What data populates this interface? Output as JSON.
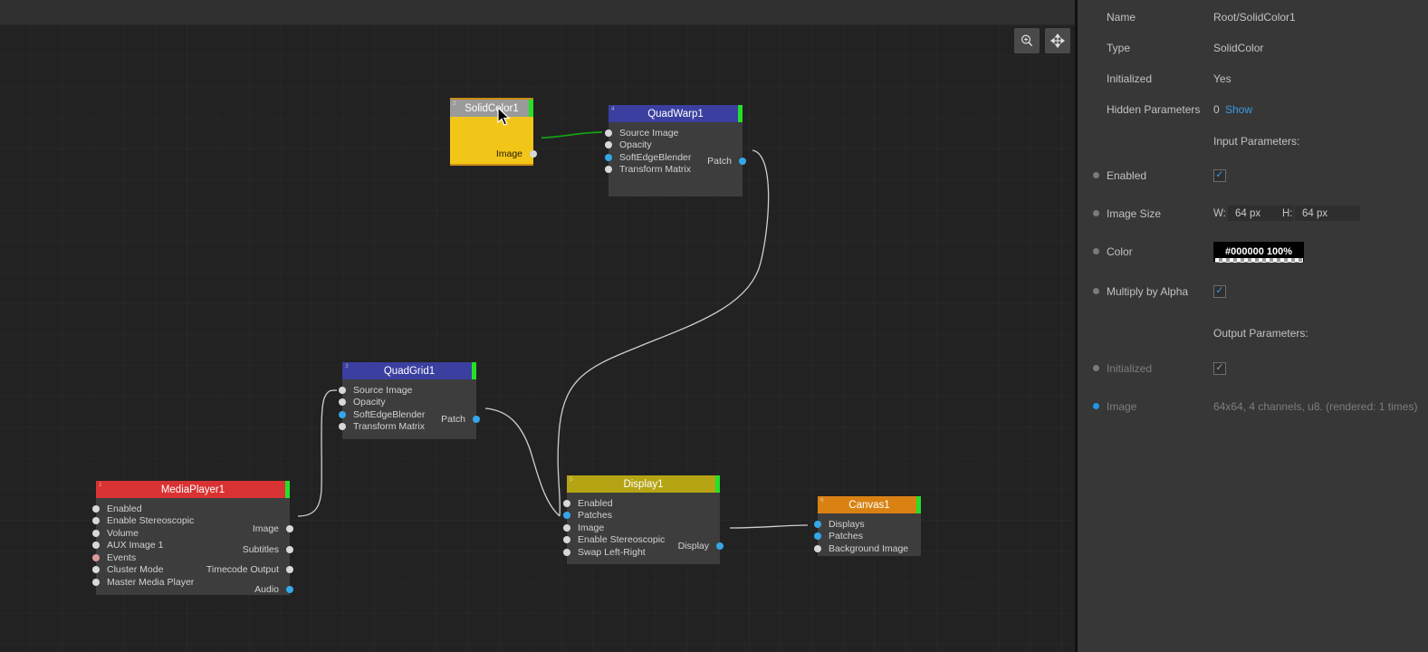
{
  "toolbar": {
    "buttons": [
      {
        "name": "zoom-in-button",
        "icon": "magnifier-plus-icon",
        "label": "Zoom"
      },
      {
        "name": "pan-button",
        "icon": "move-arrows-icon",
        "label": "Pan"
      }
    ]
  },
  "graph": {
    "nodes": [
      {
        "id": "mediaplayer1",
        "index": "1",
        "title": "MediaPlayer1",
        "header_color": "#d93232",
        "accent_color": "#26e028",
        "selected": false,
        "inputs": [
          {
            "label": "Enabled",
            "port": "white"
          },
          {
            "label": "Enable Stereoscopic",
            "port": "white"
          },
          {
            "label": "Volume",
            "port": "white"
          },
          {
            "label": "AUX Image 1",
            "port": "white"
          },
          {
            "label": "Events",
            "port": "pink"
          },
          {
            "label": "Cluster Mode",
            "port": "white"
          },
          {
            "label": "Master Media Player",
            "port": "white"
          }
        ],
        "outputs": [
          {
            "label": "Image",
            "port": "white"
          },
          {
            "label": "Subtitles",
            "port": "white"
          },
          {
            "label": "Timecode Output",
            "port": "white"
          },
          {
            "label": "Audio",
            "port": "blue"
          }
        ]
      },
      {
        "id": "quadgrid1",
        "index": "3",
        "title": "QuadGrid1",
        "header_color": "#3a3fa0",
        "accent_color": "#26e028",
        "selected": false,
        "inputs": [
          {
            "label": "Source Image",
            "port": "white"
          },
          {
            "label": "Opacity",
            "port": "white"
          },
          {
            "label": "SoftEdgeBlender",
            "port": "blue"
          },
          {
            "label": "Transform Matrix",
            "port": "white"
          }
        ],
        "outputs": [
          {
            "label": "Patch",
            "port": "blue"
          }
        ]
      },
      {
        "id": "solidcolor1",
        "index": "2",
        "title": "SolidColor1",
        "header_color": "#9a9a9a",
        "accent_color": "#26e028",
        "selected": true,
        "body_color": "#f2c519",
        "border_color": "#c98b14",
        "inputs": [],
        "outputs": [
          {
            "label": "Image",
            "port": "white"
          }
        ]
      },
      {
        "id": "quadwarp1",
        "index": "4",
        "title": "QuadWarp1",
        "header_color": "#3a3fa0",
        "accent_color": "#26e028",
        "selected": false,
        "inputs": [
          {
            "label": "Source Image",
            "port": "white"
          },
          {
            "label": "Opacity",
            "port": "white"
          },
          {
            "label": "SoftEdgeBlender",
            "port": "blue"
          },
          {
            "label": "Transform Matrix",
            "port": "white"
          }
        ],
        "outputs": [
          {
            "label": "Patch",
            "port": "blue"
          }
        ]
      },
      {
        "id": "display1",
        "index": "5",
        "title": "Display1",
        "header_color": "#b5a414",
        "accent_color": "#26e028",
        "selected": false,
        "inputs": [
          {
            "label": "Enabled",
            "port": "white"
          },
          {
            "label": "Patches",
            "port": "blue"
          },
          {
            "label": "Image",
            "port": "white"
          },
          {
            "label": "Enable Stereoscopic",
            "port": "white"
          },
          {
            "label": "Swap Left-Right",
            "port": "white"
          }
        ],
        "outputs": [
          {
            "label": "Display",
            "port": "blue"
          }
        ]
      },
      {
        "id": "canvas1",
        "index": "6",
        "title": "Canvas1",
        "header_color": "#d98213",
        "accent_color": "#26e028",
        "selected": false,
        "inputs": [
          {
            "label": "Displays",
            "port": "blue"
          },
          {
            "label": "Patches",
            "port": "blue"
          },
          {
            "label": "Background Image",
            "port": "white"
          }
        ],
        "outputs": []
      }
    ],
    "link_colors": {
      "image": "#13a013",
      "patch": "#cfcfcf",
      "display": "#cfcfcf"
    }
  },
  "panel": {
    "header_rows": [
      {
        "label": "Name",
        "value": "Root/SolidColor1"
      },
      {
        "label": "Type",
        "value": "SolidColor"
      },
      {
        "label": "Initialized",
        "value": "Yes"
      }
    ],
    "hidden_parameters": {
      "label": "Hidden Parameters",
      "value": "0",
      "action": "Show"
    },
    "input_section": "Input Parameters:",
    "output_section": "Output Parameters:",
    "enabled": {
      "label": "Enabled",
      "checked": "✓"
    },
    "image_size": {
      "label": "Image Size",
      "w_label": "W:",
      "w_value": "64 px",
      "h_label": "H:",
      "h_value": "64 px"
    },
    "color": {
      "label": "Color",
      "value": "#000000 100%",
      "swatch_hex": "#000000"
    },
    "multiply_by_alpha": {
      "label": "Multiply by Alpha",
      "checked": "✓"
    },
    "out_initialized": {
      "label": "Initialized",
      "checked": "✓"
    },
    "out_image": {
      "label": "Image",
      "value": "64x64, 4 channels, u8. (rendered: 1 times)"
    }
  }
}
